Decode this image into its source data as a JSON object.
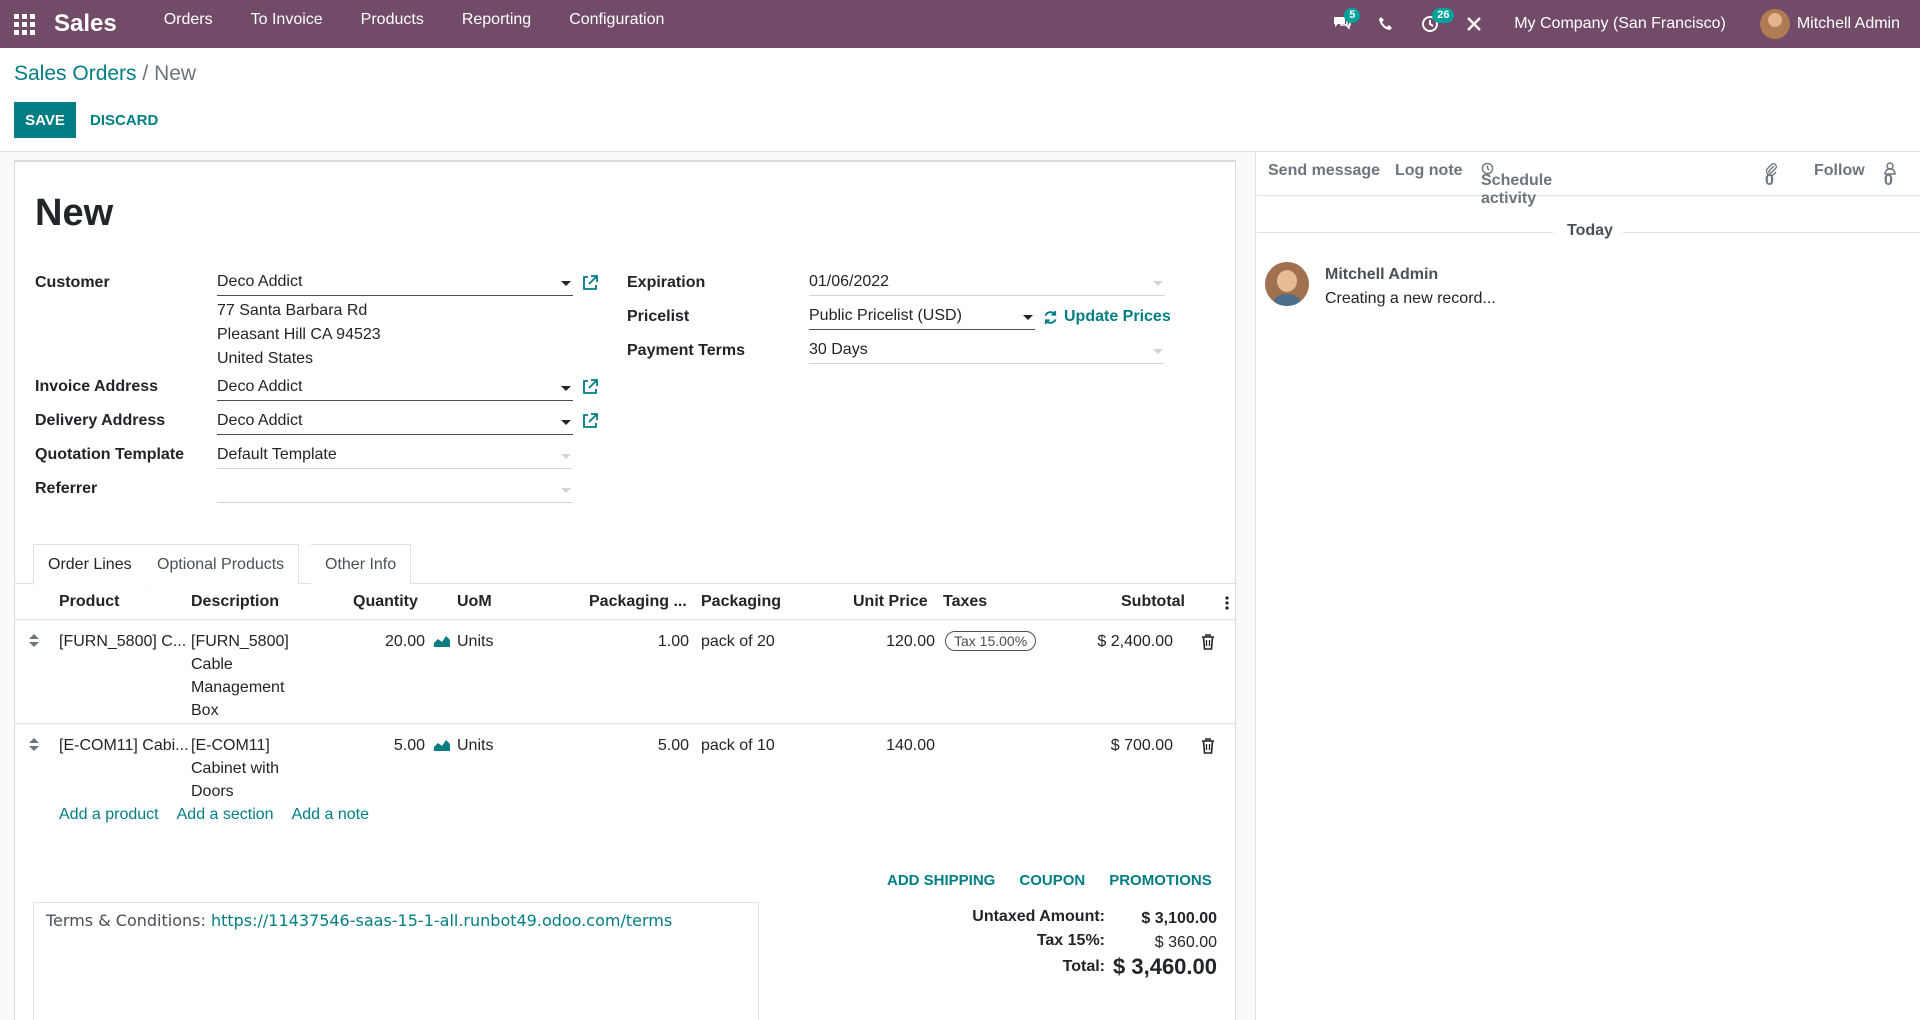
{
  "navbar": {
    "brand": "Sales",
    "menu": [
      "Orders",
      "To Invoice",
      "Products",
      "Reporting",
      "Configuration"
    ],
    "messages_count": "5",
    "activities_count": "26",
    "company": "My Company (San Francisco)",
    "user": "Mitchell Admin"
  },
  "breadcrumb": {
    "parent": "Sales Orders",
    "separator": "/",
    "current": "New"
  },
  "buttons": {
    "save": "SAVE",
    "discard": "DISCARD"
  },
  "form": {
    "title": "New",
    "customer_label": "Customer",
    "customer": "Deco Addict",
    "address": [
      "77 Santa Barbara Rd",
      "Pleasant Hill CA 94523",
      "United States"
    ],
    "invoice_label": "Invoice Address",
    "invoice_address": "Deco Addict",
    "delivery_label": "Delivery Address",
    "delivery_address": "Deco Addict",
    "template_label": "Quotation Template",
    "template": "Default Template",
    "referrer_label": "Referrer",
    "referrer": "",
    "expiration_label": "Expiration",
    "expiration": "01/06/2022",
    "pricelist_label": "Pricelist",
    "pricelist": "Public Pricelist (USD)",
    "update_prices": "Update Prices",
    "terms_label": "Payment Terms",
    "payment_terms": "30 Days"
  },
  "tabs": [
    "Order Lines",
    "Optional Products",
    "Other Info"
  ],
  "grid": {
    "headers": [
      "Product",
      "Description",
      "Quantity",
      "UoM",
      "Packaging ...",
      "Packaging",
      "Unit Price",
      "Taxes",
      "Subtotal"
    ],
    "rows": [
      {
        "product": "[FURN_5800] C...",
        "description": [
          "[FURN_5800]",
          "Cable",
          "Management",
          "Box"
        ],
        "quantity": "20.00",
        "uom": "Units",
        "pkg_qty": "1.00",
        "packaging": "pack of 20",
        "unit_price": "120.00",
        "tax": "Tax 15.00%",
        "subtotal": "$ 2,400.00"
      },
      {
        "product": "[E-COM11] Cabi...",
        "description": [
          "[E-COM11]",
          "Cabinet with",
          "Doors"
        ],
        "quantity": "5.00",
        "uom": "Units",
        "pkg_qty": "5.00",
        "packaging": "pack of 10",
        "unit_price": "140.00",
        "tax": "",
        "subtotal": "$ 700.00"
      }
    ],
    "add_links": [
      "Add a product",
      "Add a section",
      "Add a note"
    ]
  },
  "actions": [
    "ADD SHIPPING",
    "COUPON",
    "PROMOTIONS"
  ],
  "terms": {
    "label": "Terms & Conditions:",
    "url": "https://11437546-saas-15-1-all.runbot49.odoo.com/terms"
  },
  "totals": {
    "untaxed_label": "Untaxed Amount:",
    "untaxed": "$ 3,100.00",
    "tax_label": "Tax 15%:",
    "tax": "$ 360.00",
    "total_label": "Total:",
    "total": "$ 3,460.00"
  },
  "chatter": {
    "send_message": "Send message",
    "log_note": "Log note",
    "schedule_activity": "Schedule activity",
    "attachments": "0",
    "follow": "Follow",
    "followers": "0",
    "today": "Today",
    "author": "Mitchell Admin",
    "body": "Creating a new record..."
  },
  "colors": {
    "navbar": "#714B67",
    "primary": "#017E84",
    "badge": "#00A09D"
  }
}
